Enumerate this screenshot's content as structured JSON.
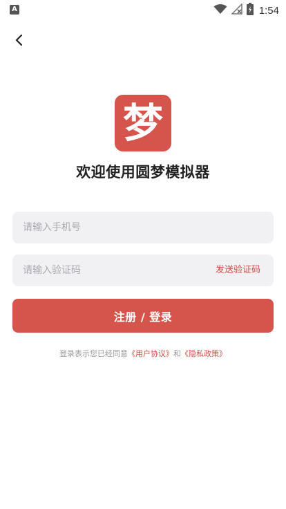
{
  "status_bar": {
    "left_icon_letter": "A",
    "time": "1:54"
  },
  "header": {
    "back_icon": "chevron-left-icon"
  },
  "logo": {
    "glyph": "梦"
  },
  "title": "欢迎使用圆梦模拟器",
  "form": {
    "phone_placeholder": "请输入手机号",
    "code_placeholder": "请输入验证码",
    "send_code_label": "发送验证码",
    "submit_label": "注册 / 登录"
  },
  "agreement": {
    "prefix": "登录表示您已经同意",
    "user_agreement": "《用户协议》",
    "conjunction": "和",
    "privacy_policy": "《隐私政策》"
  },
  "colors": {
    "accent": "#d5544b",
    "input_bg": "#f1f1f4"
  }
}
